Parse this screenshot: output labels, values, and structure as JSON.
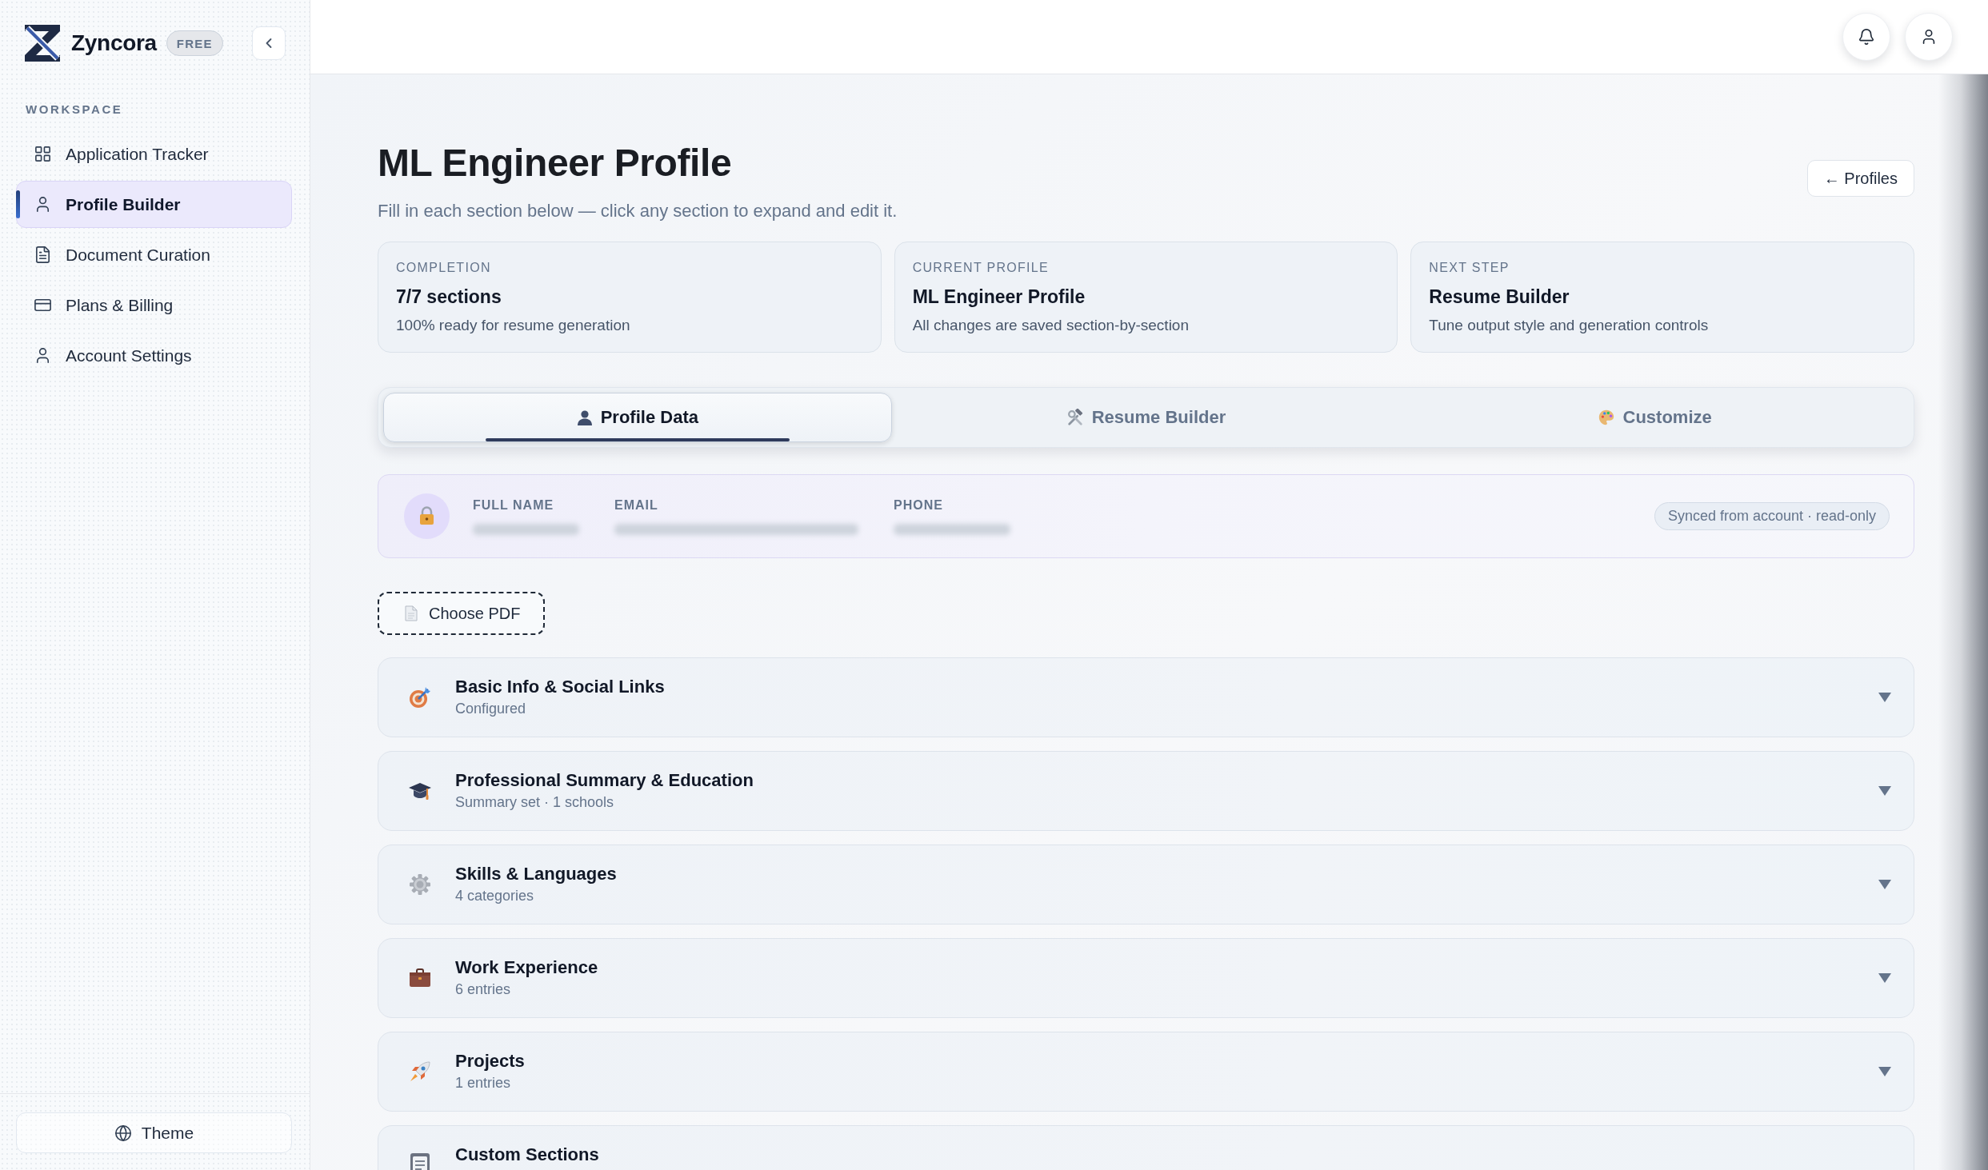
{
  "sidebar": {
    "brand": "Zyncora",
    "plan_badge": "FREE",
    "section_label": "WORKSPACE",
    "items": [
      {
        "label": "Application Tracker",
        "selected": false
      },
      {
        "label": "Profile Builder",
        "selected": true
      },
      {
        "label": "Document Curation",
        "selected": false
      },
      {
        "label": "Plans & Billing",
        "selected": false
      },
      {
        "label": "Account Settings",
        "selected": false
      }
    ],
    "theme_button": "Theme"
  },
  "page": {
    "title": "ML Engineer Profile",
    "subtitle": "Fill in each section below — click any section to expand and edit it.",
    "back_button": "← Profiles"
  },
  "stats": [
    {
      "label": "COMPLETION",
      "value": "7/7 sections",
      "detail": "100% ready for resume generation"
    },
    {
      "label": "CURRENT PROFILE",
      "value": "ML Engineer Profile",
      "detail": "All changes are saved section-by-section"
    },
    {
      "label": "NEXT STEP",
      "value": "Resume Builder",
      "detail": "Tune output style and generation controls"
    }
  ],
  "tabs": [
    {
      "label": "Profile Data",
      "selected": true
    },
    {
      "label": "Resume Builder",
      "selected": false
    },
    {
      "label": "Customize",
      "selected": false
    }
  ],
  "account": {
    "fields": [
      {
        "label": "FULL NAME"
      },
      {
        "label": "EMAIL"
      },
      {
        "label": "PHONE"
      }
    ],
    "badge": "Synced from account · read-only"
  },
  "upload_button": "Choose PDF",
  "sections": [
    {
      "title": "Basic Info & Social Links",
      "summary": "Configured",
      "expanded": false
    },
    {
      "title": "Professional Summary & Education",
      "summary": "Summary set · 1 schools",
      "expanded": false
    },
    {
      "title": "Skills & Languages",
      "summary": "4 categories",
      "expanded": false
    },
    {
      "title": "Work Experience",
      "summary": "6 entries",
      "expanded": false
    },
    {
      "title": "Projects",
      "summary": "1 entries",
      "expanded": false
    },
    {
      "title": "Custom Sections"
    }
  ]
}
